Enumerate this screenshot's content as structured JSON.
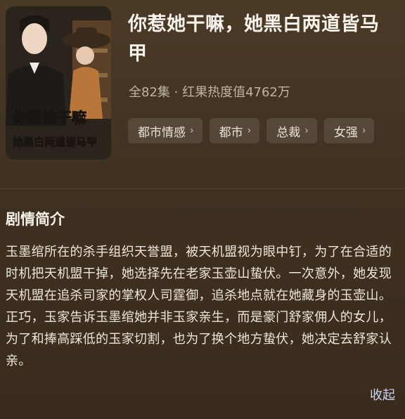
{
  "drama": {
    "poster": {
      "title_line1": "你惹她干嘛",
      "title_line2": "她黑白两道皆马甲"
    },
    "title": "你惹她干嘛，她黑白两道皆马甲",
    "meta": "全82集 · 红果热度值4762万",
    "tags": [
      {
        "label": "都市情感"
      },
      {
        "label": "都市"
      },
      {
        "label": "总裁"
      },
      {
        "label": "女强"
      }
    ]
  },
  "synopsis": {
    "heading": "剧情简介",
    "text": "玉墨绾所在的杀手组织天誉盟，被天机盟视为眼中钉，为了在合适的时机把天机盟干掉，她选择先在老家玉壶山蛰伏。一次意外，她发现天机盟在追杀司家的掌权人司霆御，追杀地点就在她藏身的玉壶山。正巧，玉家告诉玉墨绾她并非玉家亲生，而是豪门舒家佣人的女儿，为了和捧高踩低的玉家切割，也为了换个地方蛰伏，她决定去舒家认亲。",
    "collapse_label": "收起"
  },
  "icons": {
    "tag_chevron": "chevron-right-icon"
  },
  "colors": {
    "background": "#3f3020",
    "link": "#c9d6f5"
  }
}
